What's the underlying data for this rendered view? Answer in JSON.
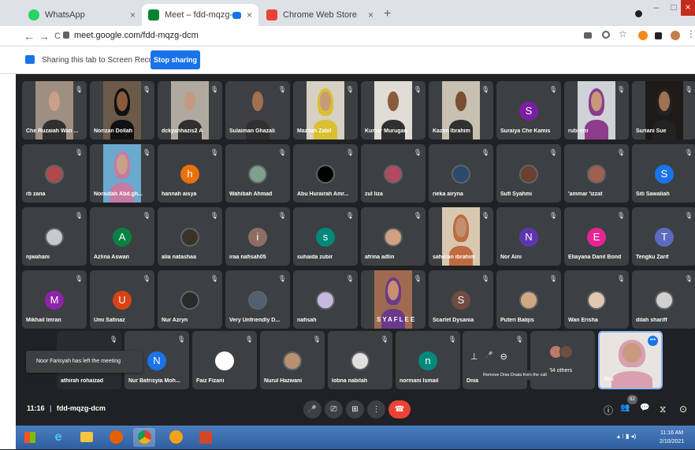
{
  "browser": {
    "tabs": [
      {
        "title": "WhatsApp",
        "close": "×",
        "fav_color": "#25d366",
        "active": false
      },
      {
        "title": "Meet – fdd-mqzg-dcm",
        "close": "×",
        "fav_color": "#00832d",
        "active": true
      },
      {
        "title": "Chrome Web Store",
        "close": "×",
        "fav_color": "#ea4335",
        "active": false
      }
    ],
    "new_tab": "+",
    "address": "meet.google.com/fdd-mqzg-dcm",
    "nav": {
      "back": "←",
      "forward": "→",
      "reload": "C"
    },
    "window": {
      "minimize": "–",
      "maximize": "□",
      "close": "×"
    },
    "right_icons": [
      "cast-icon",
      "zoom-icon",
      "star-icon",
      "extension-icon",
      "puzzle-icon",
      "profile-icon",
      "menu-icon"
    ]
  },
  "share_bar": {
    "text": "Sharing this tab to Screen Recorder",
    "button": "Stop sharing"
  },
  "participants": [
    {
      "name": "Che Ruzaiah Wan ...",
      "type": "video",
      "skin": "#c9a08a",
      "bg": "#9e8f82"
    },
    {
      "name": "Norizan Dollah",
      "type": "video",
      "skin": "#8b5a3c",
      "bg": "#6b5a4a",
      "hijab": "#111111"
    },
    {
      "name": "dckyahhazis2 A",
      "type": "video",
      "skin": "#c49a80",
      "bg": "#b0a9a0"
    },
    {
      "name": "Sulaiman Ghazali",
      "type": "video",
      "skin": "#a07050",
      "bg": "#3e3f44"
    },
    {
      "name": "Mazilah Zabil",
      "type": "video",
      "skin": "#c89a78",
      "bg": "#d7d0c3",
      "hijab": "#d9c030"
    },
    {
      "name": "Kumar Murugan",
      "type": "video",
      "skin": "#8a5c3c",
      "bg": "#e0dcd6"
    },
    {
      "name": "Kazim Ibrahim",
      "type": "video",
      "skin": "#7a4e32",
      "bg": "#c8c0b0"
    },
    {
      "name": "Suraiya Che Kamis",
      "type": "initial",
      "letter": "S",
      "color": "#7b1fa2"
    },
    {
      "name": "rubi eni",
      "type": "video",
      "skin": "#c8987a",
      "bg": "#cfd2d6",
      "hijab": "#8e3c8c"
    },
    {
      "name": "Suriani Sue",
      "type": "video",
      "skin": "#a07250",
      "bg": "#1d1a18",
      "hijab": "#222222"
    },
    {
      "name": "rb zana",
      "type": "avatar",
      "color": "#b04a4a"
    },
    {
      "name": "Noraidah Abd.gh...",
      "type": "video",
      "skin": "#c8a08a",
      "bg": "#6ba9cf",
      "hijab": "#c87aa0"
    },
    {
      "name": "hannah aisya",
      "type": "initial",
      "letter": "h",
      "color": "#e8710a"
    },
    {
      "name": "Wahibah Ahmad",
      "type": "avatar",
      "color": "#7fa08c"
    },
    {
      "name": "Abu Hurairah Amr...",
      "type": "avatar",
      "color": "#000000"
    },
    {
      "name": "zul liza",
      "type": "avatar",
      "color": "#b04a5c"
    },
    {
      "name": "rieka airyna",
      "type": "avatar",
      "color": "#2a4a6a"
    },
    {
      "name": "Sufi Syahmi",
      "type": "avatar",
      "color": "#6a4030"
    },
    {
      "name": "'ammar 'izzat",
      "type": "avatar",
      "color": "#9e6050"
    },
    {
      "name": "Siti Sawaliah",
      "type": "initial",
      "letter": "S",
      "color": "#1a73e8"
    },
    {
      "name": "njwahani",
      "type": "avatar",
      "color": "#c8c8d0"
    },
    {
      "name": "Azlina Aswan",
      "type": "initial",
      "letter": "A",
      "color": "#0b8043"
    },
    {
      "name": "alia natashaa",
      "type": "avatar",
      "color": "#3a3228"
    },
    {
      "name": "iraa nafisah05",
      "type": "initial",
      "letter": "i",
      "color": "#8d6e63"
    },
    {
      "name": "suhaida zubir",
      "type": "initial",
      "letter": "s",
      "color": "#00897b"
    },
    {
      "name": "afrina adlin",
      "type": "avatar",
      "color": "#d0a080"
    },
    {
      "name": "saheran ibrahim",
      "type": "video",
      "skin": "#c09070",
      "bg": "#d8c8b0",
      "hijab": "#c06a40"
    },
    {
      "name": "Nor Aini",
      "type": "initial",
      "letter": "N",
      "color": "#5e35b1"
    },
    {
      "name": "Eliayana Danil Bond",
      "type": "initial",
      "letter": "E",
      "color": "#e52592"
    },
    {
      "name": "Tengku Zarif",
      "type": "initial",
      "letter": "T",
      "color": "#5c6bc0"
    },
    {
      "name": "Mikhail Imran",
      "type": "initial",
      "letter": "M",
      "color": "#8e24aa"
    },
    {
      "name": "Umi Safinaz",
      "type": "initial",
      "letter": "U",
      "color": "#d84315"
    },
    {
      "name": "Nur Azryn",
      "type": "avatar",
      "color": "#2a2a2a"
    },
    {
      "name": "Very Unfriendly D...",
      "type": "avatar",
      "color": "#506070"
    },
    {
      "name": "nafisah",
      "type": "avatar",
      "color": "#c8b8e0"
    },
    {
      "name": "SYAFLEE",
      "type": "video",
      "skin": "#c89070",
      "bg": "#a06a50",
      "hijab": "#6a3a8a"
    },
    {
      "name": "Scarlet Dysania",
      "type": "initial",
      "letter": "S",
      "color": "#6d4c41"
    },
    {
      "name": "Puteri Balqis",
      "type": "avatar",
      "color": "#d0a880"
    },
    {
      "name": "Wan Erisha",
      "type": "avatar",
      "color": "#e0c8b0"
    },
    {
      "name": "dilah shariff",
      "type": "avatar",
      "color": "#d0d0d0"
    },
    {
      "name": "athirah rohaizad",
      "type": "hidden"
    },
    {
      "name": "Nur Batrisyia Moh...",
      "type": "initial",
      "letter": "N",
      "color": "#1a73e8"
    },
    {
      "name": "Faiz Fizani",
      "type": "initial",
      "letter": "",
      "color": "#ffffff"
    },
    {
      "name": "Nurul Hazwani",
      "type": "avatar",
      "color": "#b89070"
    },
    {
      "name": "lobna nabilah",
      "type": "avatar",
      "color": "#e0e0e0"
    },
    {
      "name": "normani Ismail",
      "type": "initial",
      "letter": "n",
      "color": "#00897b"
    },
    {
      "name": "Dnia",
      "type": "hover"
    },
    {
      "name": "34 others",
      "type": "others"
    },
    {
      "name": "You",
      "type": "self",
      "skin": "#c89a80",
      "bg": "#e8e4e0",
      "hijab": "#d8a0b0",
      "badge": "•••"
    }
  ],
  "toast": "Noor Farisyah has left the meeting",
  "tooltip": "Remove Dnia Dnaia from the call",
  "toolbar": {
    "time": "11:16",
    "separator": "|",
    "code": "fdd-mqzg-dcm",
    "controls": {
      "mic": "🎤",
      "camera": "⎚",
      "present": "⊞",
      "more": "⋮",
      "end": "☎"
    },
    "participant_count": "82",
    "right": {
      "info": "ⓘ",
      "people": "👥",
      "chat": "💬",
      "activities": "⧖",
      "safety": "⊙"
    }
  },
  "taskbar": {
    "apps": [
      "windows-start-icon",
      "ie-icon",
      "explorer-icon",
      "firefox-icon",
      "chrome-icon",
      "orb-icon",
      "powerpoint-icon"
    ],
    "tray": "▴ ⁝ ▮ ◂)",
    "time": "11:16 AM",
    "date": "2/10/2021"
  }
}
